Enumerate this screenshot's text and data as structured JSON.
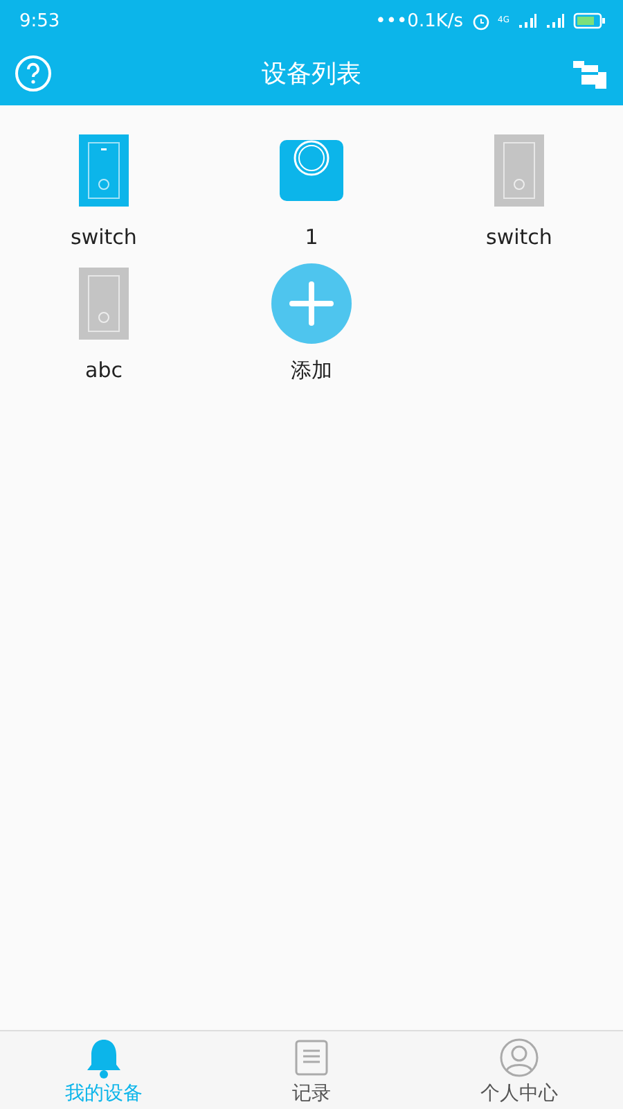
{
  "status_bar": {
    "time": "9:53",
    "speed": "•••0.1K/s",
    "network": "4G"
  },
  "header": {
    "title": "设备列表"
  },
  "devices": [
    {
      "kind": "switch",
      "name": "switch",
      "on": true
    },
    {
      "kind": "scale",
      "name": "1",
      "on": true
    },
    {
      "kind": "switch",
      "name": "switch",
      "on": false
    },
    {
      "kind": "switch",
      "name": "abc",
      "on": false
    },
    {
      "kind": "add",
      "name": "添加"
    }
  ],
  "tabs": [
    {
      "kind": "bell",
      "label": "我的设备",
      "selected": true
    },
    {
      "kind": "record",
      "label": "记录",
      "selected": false
    },
    {
      "kind": "user",
      "label": "个人中心",
      "selected": false
    }
  ]
}
